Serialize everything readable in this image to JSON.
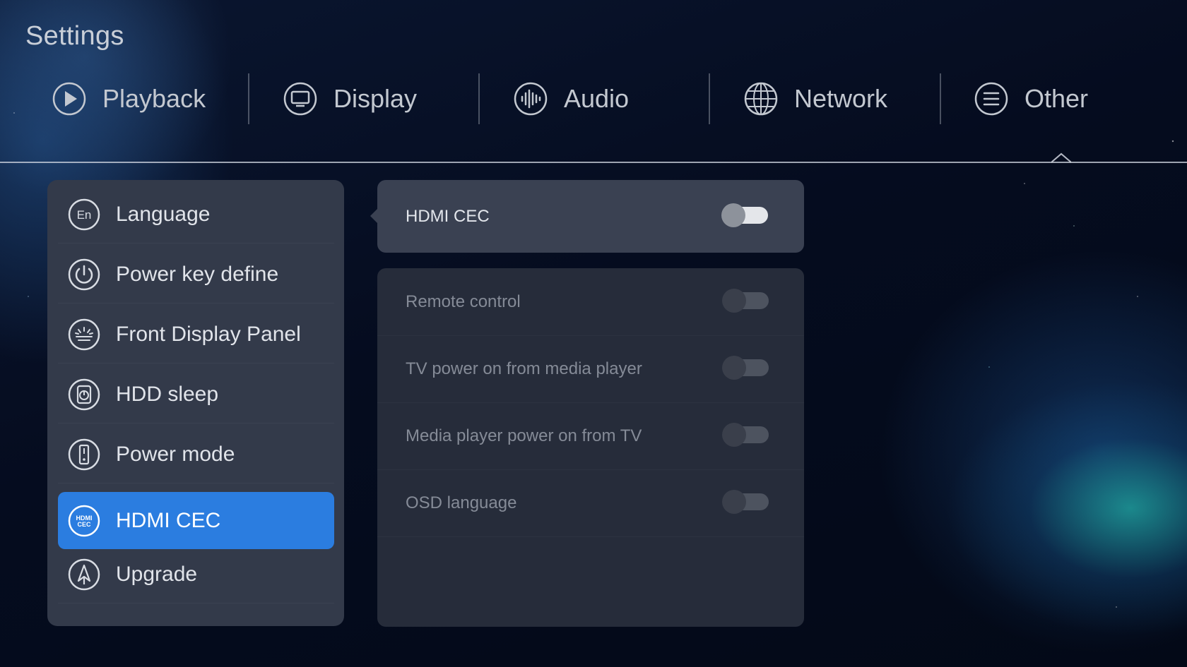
{
  "header": {
    "title": "Settings"
  },
  "tabs": [
    {
      "label": "Playback",
      "icon": "play-icon"
    },
    {
      "label": "Display",
      "icon": "monitor-icon"
    },
    {
      "label": "Audio",
      "icon": "audio-wave-icon"
    },
    {
      "label": "Network",
      "icon": "globe-icon"
    },
    {
      "label": "Other",
      "icon": "menu-lines-icon",
      "selected": true
    }
  ],
  "sidebar": {
    "items": [
      {
        "label": "Language",
        "icon": "language-en-icon"
      },
      {
        "label": "Power key define",
        "icon": "power-icon"
      },
      {
        "label": "Front Display Panel",
        "icon": "front-panel-icon"
      },
      {
        "label": "HDD sleep",
        "icon": "hdd-sleep-icon"
      },
      {
        "label": "Power mode",
        "icon": "power-mode-icon"
      },
      {
        "label": "HDMI CEC",
        "icon": "hdmi-cec-icon",
        "selected": true,
        "icon_text": "HDMI CEC"
      },
      {
        "label": "Upgrade",
        "icon": "upgrade-icon"
      }
    ]
  },
  "detail": {
    "main_toggle": {
      "label": "HDMI CEC",
      "state": "off"
    },
    "options": [
      {
        "label": "Remote control",
        "state": "off"
      },
      {
        "label": "TV power on from media player",
        "state": "off"
      },
      {
        "label": "Media player power on from TV",
        "state": "off"
      },
      {
        "label": "OSD language",
        "state": "off"
      }
    ]
  },
  "colors": {
    "accent": "#2b7de0",
    "panel": "#333a4a",
    "subpanel": "#262c3a",
    "text_dim": "#858b97"
  }
}
